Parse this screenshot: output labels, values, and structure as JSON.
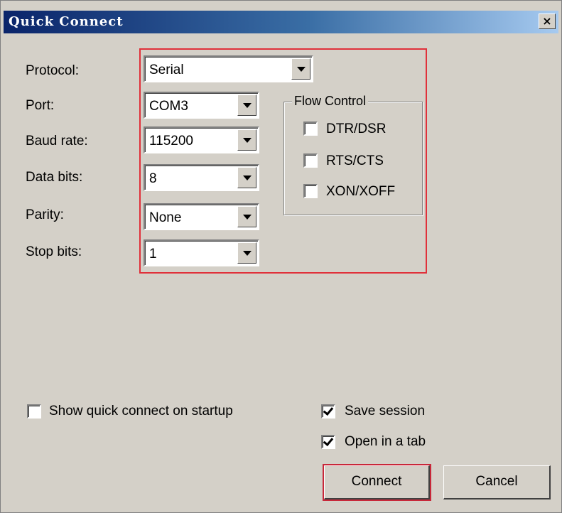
{
  "window": {
    "title": "Quick Connect",
    "close_glyph": "×"
  },
  "form": {
    "protocol": {
      "label": "Protocol:",
      "value": "Serial"
    },
    "port": {
      "label": "Port:",
      "value": "COM3"
    },
    "baud_rate": {
      "label": "Baud rate:",
      "value": "115200"
    },
    "data_bits": {
      "label": "Data bits:",
      "value": "8"
    },
    "parity": {
      "label": "Parity:",
      "value": "None"
    },
    "stop_bits": {
      "label": "Stop bits:",
      "value": "1"
    }
  },
  "flow_control": {
    "legend": "Flow Control",
    "options": [
      {
        "label": "DTR/DSR",
        "checked": false
      },
      {
        "label": "RTS/CTS",
        "checked": false
      },
      {
        "label": "XON/XOFF",
        "checked": false
      }
    ]
  },
  "options": {
    "show_on_startup": {
      "label": "Show quick connect on startup",
      "checked": false
    },
    "save_session": {
      "label": "Save session",
      "checked": true
    },
    "open_in_tab": {
      "label": "Open in a tab",
      "checked": true
    }
  },
  "buttons": {
    "connect": "Connect",
    "cancel": "Cancel"
  },
  "colors": {
    "dialog_bg": "#d4d0c8",
    "titlebar_start": "#0a246a",
    "titlebar_end": "#a6caf0",
    "highlight_frame": "#e0303a"
  }
}
